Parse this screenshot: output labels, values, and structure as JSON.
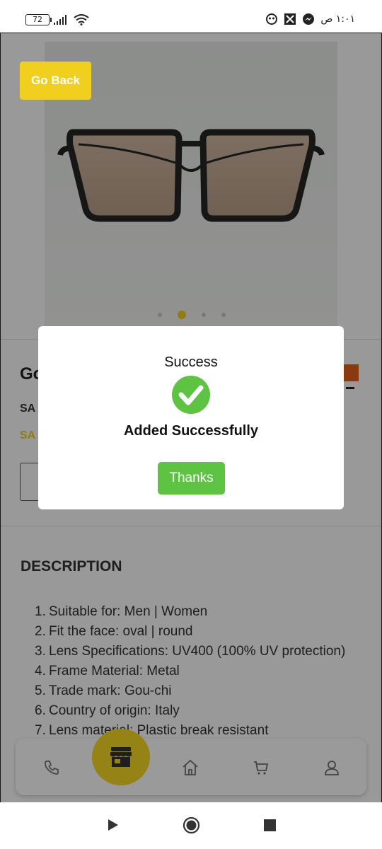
{
  "status_bar": {
    "battery": "72",
    "time": "١:٠١ ص"
  },
  "product": {
    "go_back_label": "Go Back",
    "title_partial": "Go",
    "price_label_partial": "SA",
    "sale_label_partial": "SA",
    "image_dots": {
      "count": 4,
      "active_index": 1
    },
    "swatch_color": "#e8621a"
  },
  "description": {
    "heading": "DESCRIPTION",
    "items": [
      {
        "num": "1.",
        "text": "Suitable for: Men | Women"
      },
      {
        "num": "2.",
        "text": "Fit the face: oval | round"
      },
      {
        "num": "3.",
        "text": "Lens Specifications: UV400 (100% UV protection)"
      },
      {
        "num": "4.",
        "text": "Frame Material: Metal"
      },
      {
        "num": "5.",
        "text": "Trade mark: Gou-chi"
      },
      {
        "num": "6.",
        "text": "Country of origin: Italy"
      },
      {
        "num": "7.",
        "text": "Lens material: Plastic break resistant"
      }
    ]
  },
  "dialog": {
    "title": "Success",
    "message": "Added Successfully",
    "button_label": "Thanks",
    "accent_color": "#5ec342"
  },
  "bottom_nav": {
    "items": [
      "phone-icon",
      "store-icon",
      "home-icon",
      "cart-icon",
      "profile-icon"
    ],
    "active": "store-icon",
    "accent_color": "#f1cf1e"
  }
}
